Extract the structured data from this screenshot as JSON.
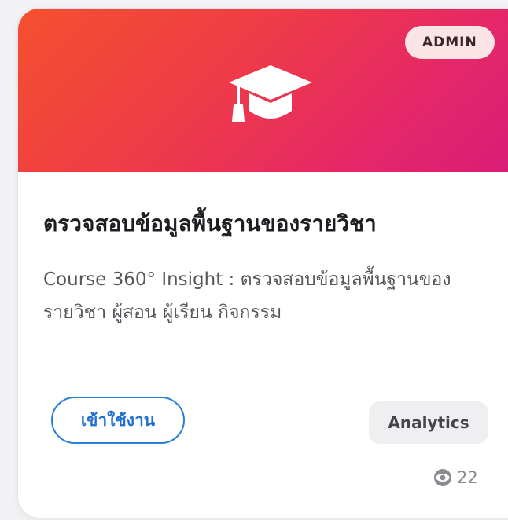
{
  "card": {
    "badge": "ADMIN",
    "title": "ตรวจสอบข้อมูลพื้นฐานของรายวิชา",
    "description": "Course 360° Insight : ตรวจสอบข้อมูลพื้นฐานของรายวิชา ผู้สอน ผู้เรียน กิจกรรม",
    "enter_button": "เข้าใช้งาน",
    "category_tag": "Analytics",
    "views": "22",
    "hero_icon": "graduation-cap-icon",
    "view_icon": "eye-icon"
  },
  "colors": {
    "hero_gradient_start": "#f4502f",
    "hero_gradient_end": "#d81b78",
    "badge_background": "#fbe4e6",
    "button_accent": "#2b7fd8",
    "tag_background": "#efeff2"
  }
}
